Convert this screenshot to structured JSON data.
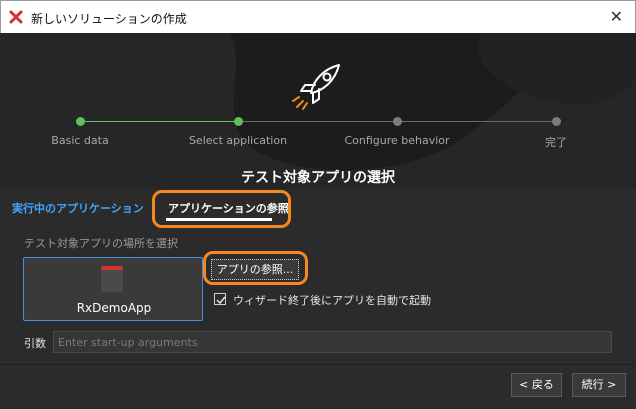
{
  "window": {
    "title": "新しいソリューションの作成",
    "close_glyph": "✕",
    "accent_color": "#d63030"
  },
  "steps": [
    {
      "label": "Basic data",
      "state": "done"
    },
    {
      "label": "Select application",
      "state": "current"
    },
    {
      "label": "Configure behavior",
      "state": "todo"
    },
    {
      "label": "完了",
      "state": "todo"
    }
  ],
  "page": {
    "heading": "テスト対象アプリの選択"
  },
  "tabs": {
    "running": "実行中のアプリケーション",
    "browse": "アプリケーションの参照"
  },
  "browse_panel": {
    "section_label": "テスト対象アプリの場所を選択",
    "app_name": "RxDemoApp",
    "browse_button": "アプリの参照...",
    "autostart_label": "ウィザード終了後にアプリを自動で起動",
    "autostart_checked": true
  },
  "arguments": {
    "label": "引数",
    "placeholder": "Enter start-up arguments",
    "value": ""
  },
  "footer": {
    "back": "< 戻る",
    "next": "続行 >"
  },
  "colors": {
    "highlight": "#f5891f",
    "link": "#3fa7ff",
    "step_done": "#5cc25c"
  }
}
